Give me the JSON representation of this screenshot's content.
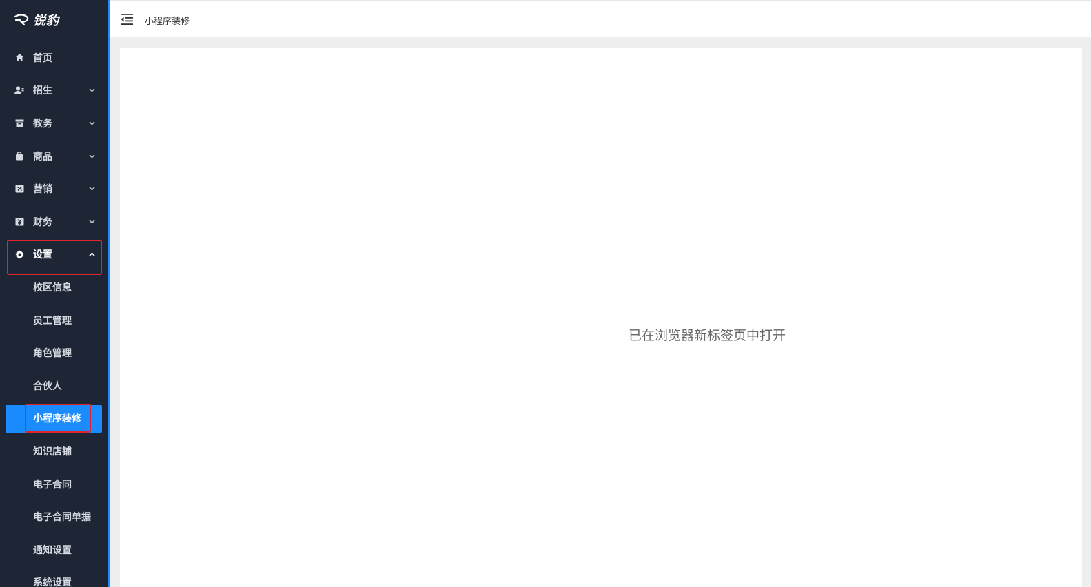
{
  "brand": {
    "name": "锐豹"
  },
  "sidebar": {
    "items": [
      {
        "label": "首页",
        "icon": "home-icon"
      },
      {
        "label": "招生",
        "icon": "user-icon"
      },
      {
        "label": "教务",
        "icon": "archive-icon"
      },
      {
        "label": "商品",
        "icon": "shopping-bag-icon"
      },
      {
        "label": "营销",
        "icon": "coupon-icon"
      },
      {
        "label": "财务",
        "icon": "yen-icon"
      },
      {
        "label": "设置",
        "icon": "gear-icon"
      }
    ],
    "settings_sub": [
      {
        "label": "校区信息"
      },
      {
        "label": "员工管理"
      },
      {
        "label": "角色管理"
      },
      {
        "label": "合伙人"
      },
      {
        "label": "小程序装修"
      },
      {
        "label": "知识店铺"
      },
      {
        "label": "电子合同"
      },
      {
        "label": "电子合同单据"
      },
      {
        "label": "通知设置"
      },
      {
        "label": "系统设置"
      }
    ]
  },
  "header": {
    "title": "小程序装修"
  },
  "main": {
    "message": "已在浏览器新标签页中打开"
  },
  "colors": {
    "sidebar_bg": "#1e2534",
    "accent": "#1a8cff",
    "highlight": "#e0242a"
  }
}
